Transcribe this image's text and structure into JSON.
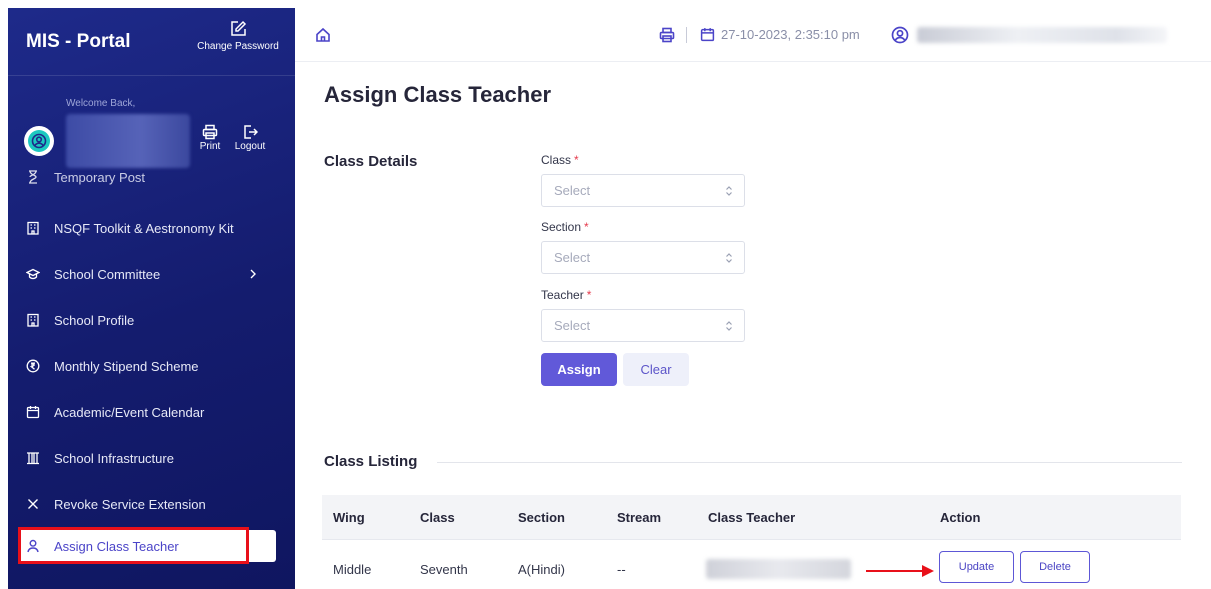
{
  "sidebar": {
    "title": "MIS - Portal",
    "change_password": "Change Password",
    "welcome": "Welcome Back,",
    "print_label": "Print",
    "logout_label": "Logout",
    "items": [
      {
        "label": "Temporary Post",
        "icon": "hourglass-icon"
      },
      {
        "label": "NSQF Toolkit & Aestronomy Kit",
        "icon": "building-icon"
      },
      {
        "label": "School Committee",
        "icon": "mortarboard-icon"
      },
      {
        "label": "School Profile",
        "icon": "building-icon"
      },
      {
        "label": "Monthly Stipend Scheme",
        "icon": "rupee-coin-icon"
      },
      {
        "label": "Academic/Event Calendar",
        "icon": "calendar-icon"
      },
      {
        "label": "School Infrastructure",
        "icon": "columns-icon"
      },
      {
        "label": "Revoke Service Extension",
        "icon": "close-icon"
      },
      {
        "label": "Assign Class Teacher",
        "icon": "user-icon"
      }
    ]
  },
  "topbar": {
    "datetime": "27-10-2023, 2:35:10 pm"
  },
  "main": {
    "title": "Assign Class Teacher",
    "class_details_label": "Class Details",
    "fields": [
      {
        "label": "Class",
        "placeholder": "Select"
      },
      {
        "label": "Section",
        "placeholder": "Select"
      },
      {
        "label": "Teacher",
        "placeholder": "Select"
      }
    ],
    "required_mark": "*",
    "assign_label": "Assign",
    "clear_label": "Clear",
    "listing_label": "Class Listing",
    "table": {
      "headers": [
        "Wing",
        "Class",
        "Section",
        "Stream",
        "Class Teacher",
        "Action"
      ],
      "rows": [
        {
          "wing": "Middle",
          "class": "Seventh",
          "section": "A(Hindi)",
          "stream": "--"
        }
      ],
      "update_label": "Update",
      "delete_label": "Delete"
    }
  },
  "colors": {
    "sidebar_bg": "#141c6e",
    "accent": "#6159d9",
    "highlight": "#e8101a"
  }
}
